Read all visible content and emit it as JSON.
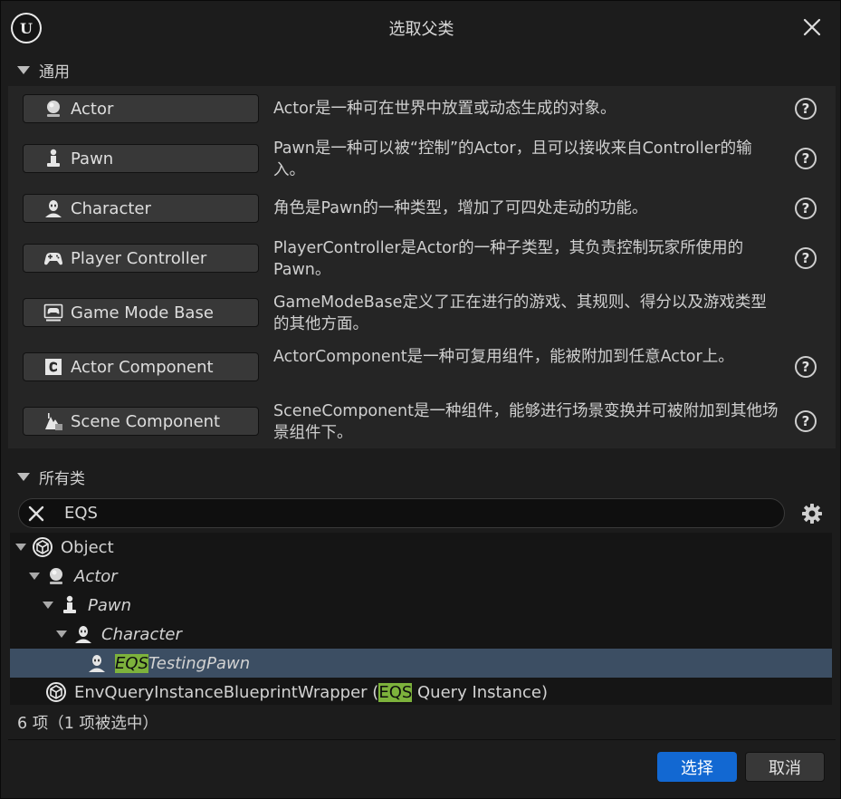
{
  "dialog": {
    "title": "选取父类",
    "logo_icon": "unreal-engine-logo-icon",
    "close_icon": "close-icon"
  },
  "common_section": {
    "header": "通用",
    "items": [
      {
        "label": "Actor",
        "icon": "actor-sphere-icon",
        "description": "Actor是一种可在世界中放置或动态生成的对象。"
      },
      {
        "label": "Pawn",
        "icon": "pawn-icon",
        "description": "Pawn是一种可以被“控制”的Actor，且可以接收来自Controller的输入。"
      },
      {
        "label": "Character",
        "icon": "character-bust-icon",
        "description": "角色是Pawn的一种类型，增加了可四处走动的功能。"
      },
      {
        "label": "Player Controller",
        "icon": "gamepad-icon",
        "description": "PlayerController是Actor的一种子类型，其负责控制玩家所使用的Pawn。"
      },
      {
        "label": "Game Mode Base",
        "icon": "game-mode-icon",
        "description": "GameModeBase定义了正在进行的游戏、其规则、得分以及游戏类型的其他方面。"
      },
      {
        "label": "Actor Component",
        "icon": "actor-component-icon",
        "description": "ActorComponent是一种可复用组件，能被附加到任意Actor上。"
      },
      {
        "label": "Scene Component",
        "icon": "scene-component-icon",
        "description": "SceneComponent是一种组件，能够进行场景变换并可被附加到其他场景组件下。"
      }
    ],
    "help_icon_glyph": "?"
  },
  "all_classes_section": {
    "header": "所有类",
    "search": {
      "value": "EQS",
      "clear_icon": "clear-icon"
    },
    "settings_icon": "gear-icon",
    "tree": [
      {
        "label": "Object",
        "depth": 0,
        "expanded": true,
        "italic": false,
        "icon": "object-icon"
      },
      {
        "label": "Actor",
        "depth": 1,
        "expanded": true,
        "italic": true,
        "icon": "actor-sphere-icon"
      },
      {
        "label": "Pawn",
        "depth": 2,
        "expanded": true,
        "italic": true,
        "icon": "pawn-icon"
      },
      {
        "label": "Character",
        "depth": 3,
        "expanded": true,
        "italic": true,
        "icon": "character-bust-icon"
      },
      {
        "label_match": "EQS",
        "label_rest": "TestingPawn",
        "depth": 4,
        "selected": true,
        "italic": true,
        "icon": "character-bust-icon"
      },
      {
        "label_pre": "EnvQueryInstanceBlueprintWrapper (",
        "label_match": "EQS",
        "label_rest": " Query Instance)",
        "depth": 1,
        "italic": false,
        "icon": "object-icon"
      }
    ],
    "status": "6 项（1 项被选中）"
  },
  "footer": {
    "select_label": "选择",
    "cancel_label": "取消"
  },
  "colors": {
    "accent": "#1268d2",
    "selection": "#3c4e63",
    "search_highlight": "#7db23c"
  }
}
